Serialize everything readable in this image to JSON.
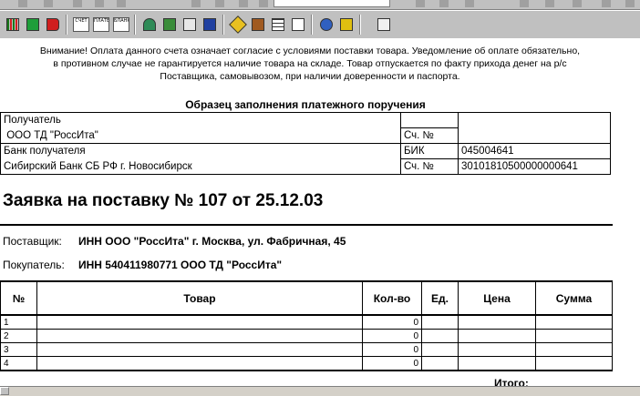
{
  "toolbar": {
    "icons": [
      "barcode-icon",
      "import-icon",
      "export-icon",
      "invoice-icon",
      "payment-order-icon",
      "form-icon",
      "bank-icon",
      "calculator-icon",
      "report-icon",
      "people-icon",
      "pencil-icon",
      "boxes-icon",
      "table-icon",
      "chart-icon",
      "globe-icon",
      "calendar-icon",
      "help-icon"
    ],
    "invoice_label": "СЧЕТ",
    "payment_label": "ПЛАТЕЖ",
    "form_label": "БЛАНК"
  },
  "notice": "Внимание! Оплата данного счета означает согласие с условиями поставки товара. Уведомление об оплате обязательно, в противном случае не гарантируется наличие товара на складе. Товар отпускается по факту прихода денег на р/с Поставщика, самовывозом, при наличии доверенности и паспорта.",
  "payment_order": {
    "title": "Образец заполнения платежного поручения",
    "recipient_label": "Получатель",
    "recipient_name": "ООО ТД \"РоссИта\"",
    "account_no_label": "Сч. №",
    "account_no_value": "",
    "bank_label": "Банк получателя",
    "bank_name": "Сибирский Банк СБ РФ г. Новосибирск",
    "bik_label": "БИК",
    "bik_value": "045004641",
    "corr_account_label": "Сч. №",
    "corr_account_value": "30101810500000000641"
  },
  "order": {
    "title": "Заявка на поставку № 107 от 25.12.03",
    "supplier_label": "Поставщик:",
    "supplier_value": "ИНН  ООО \"РоссИта\" г. Москва, ул. Фабричная, 45",
    "buyer_label": "Покупатель:",
    "buyer_value": "ИНН 540411980771 ООО ТД \"РоссИта\""
  },
  "items_table": {
    "columns": [
      "№",
      "Товар",
      "Кол-во",
      "Ед.",
      "Цена",
      "Сумма"
    ],
    "rows": [
      {
        "n": "1",
        "product": "",
        "qty": "0",
        "unit": "",
        "price": "",
        "sum": ""
      },
      {
        "n": "2",
        "product": "",
        "qty": "0",
        "unit": "",
        "price": "",
        "sum": ""
      },
      {
        "n": "3",
        "product": "",
        "qty": "0",
        "unit": "",
        "price": "",
        "sum": ""
      },
      {
        "n": "4",
        "product": "",
        "qty": "0",
        "unit": "",
        "price": "",
        "sum": ""
      }
    ],
    "total_label": "Итого:"
  }
}
